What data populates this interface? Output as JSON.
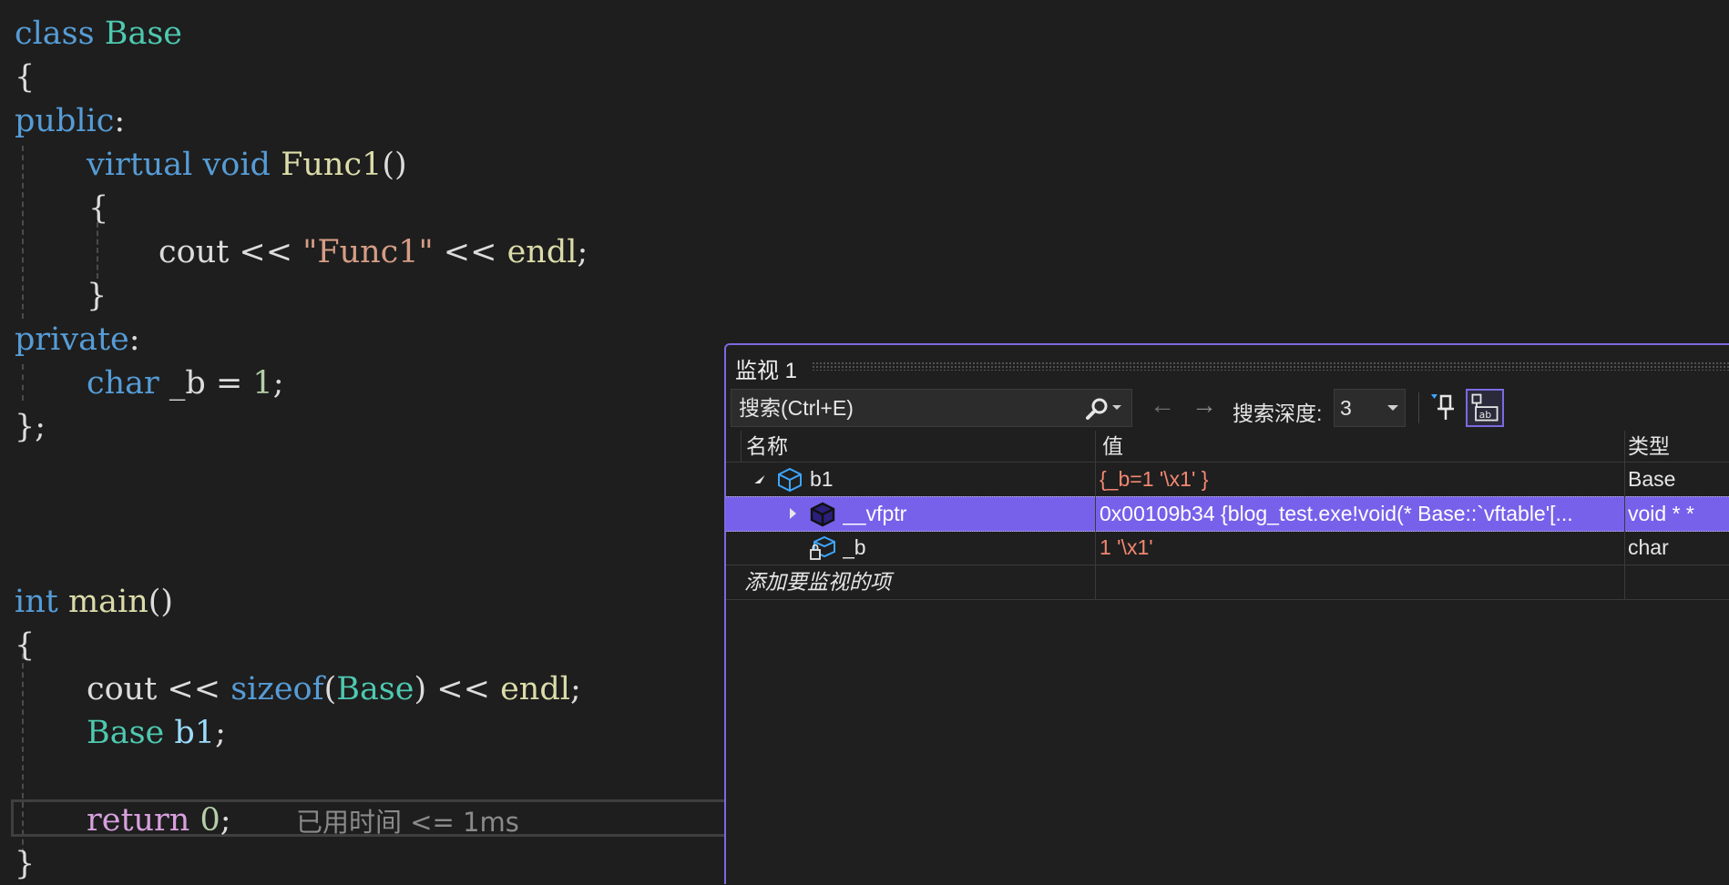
{
  "editor": {
    "lines": {
      "l1": {
        "kw": "class",
        "name": "Base"
      },
      "l2": {
        "brace": "{"
      },
      "l3": {
        "access": "public",
        "colon": ":"
      },
      "l4": {
        "kw1": "virtual",
        "kw2": "void",
        "fn": "Func1",
        "paren": "()"
      },
      "l5": {
        "brace": "{"
      },
      "l6": {
        "obj": "cout",
        "op1": "<<",
        "str": "\"Func1\"",
        "op2": "<<",
        "endl": "endl",
        "semi": ";"
      },
      "l7": {
        "brace": "}"
      },
      "l8": {
        "access": "private",
        "colon": ":"
      },
      "l9": {
        "kw": "char",
        "name": "_b",
        "eq": "=",
        "num": "1",
        "semi": ";"
      },
      "l10": {
        "brace": "};"
      },
      "l11": {
        "kw": "int",
        "fn": "main",
        "paren": "()"
      },
      "l12": {
        "brace": "{"
      },
      "l13": {
        "obj": "cout",
        "op1": "<<",
        "sizeof": "sizeof",
        "popen": "(",
        "type": "Base",
        "pclose": ")",
        "op2": "<<",
        "endl": "endl",
        "semi": ";"
      },
      "l14": {
        "type": "Base",
        "var": "b1",
        "semi": ";"
      },
      "l15": {
        "kw": "return",
        "num": "0",
        "semi": ";"
      },
      "l16": {
        "brace": "}"
      }
    },
    "perf_tip": "已用时间 <= 1ms"
  },
  "watch": {
    "title": "监视 1",
    "search_placeholder": "搜索(Ctrl+E)",
    "back_arrow": "←",
    "forward_arrow": "→",
    "depth_label": "搜索深度:",
    "depth_value": "3",
    "columns": {
      "name": "名称",
      "value": "值",
      "type": "类型"
    },
    "rows": [
      {
        "name": "b1",
        "value": "{_b=1 '\\x1' }",
        "type": "Base",
        "expanded": true,
        "selected": false
      },
      {
        "name": "__vfptr",
        "value": "0x00109b34 {blog_test.exe!void(* Base::`vftable'[...",
        "type": "void * *",
        "expanded": false,
        "selected": true
      },
      {
        "name": "_b",
        "value": "1 '\\x1'",
        "type": "char",
        "selected": false
      }
    ],
    "add_item": "添加要监视的项"
  },
  "colors": {
    "accent": "#7c6ae0",
    "selection": "#7761ea",
    "value_text": "#f48771",
    "keyword": "#569cd6",
    "type": "#4ec9b0",
    "function": "#dcdcaa",
    "string": "#d69d85",
    "control": "#d8a0df"
  },
  "icons": {
    "search": "search-icon",
    "object": "object-cube-icon",
    "private_member": "private-lock-icon",
    "pin": "pin-icon",
    "hex": "hex-display-icon"
  }
}
